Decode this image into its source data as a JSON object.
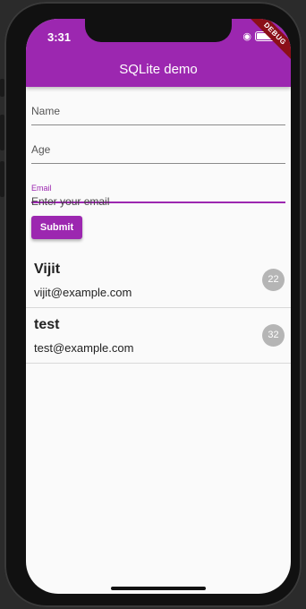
{
  "status_bar": {
    "time": "3:31",
    "debug_label": "DEBUG"
  },
  "appbar": {
    "title": "SQLite demo"
  },
  "form": {
    "name_label": "Name",
    "age_label": "Age",
    "email_label": "Email",
    "email_placeholder": "Enter your email",
    "submit_label": "Submit"
  },
  "users": [
    {
      "name": "Vijit",
      "email": "vijit@example.com",
      "age": "22"
    },
    {
      "name": "test",
      "email": "test@example.com",
      "age": "32"
    }
  ],
  "colors": {
    "primary": "#9c27b0",
    "badge": "#b5b5b5"
  }
}
